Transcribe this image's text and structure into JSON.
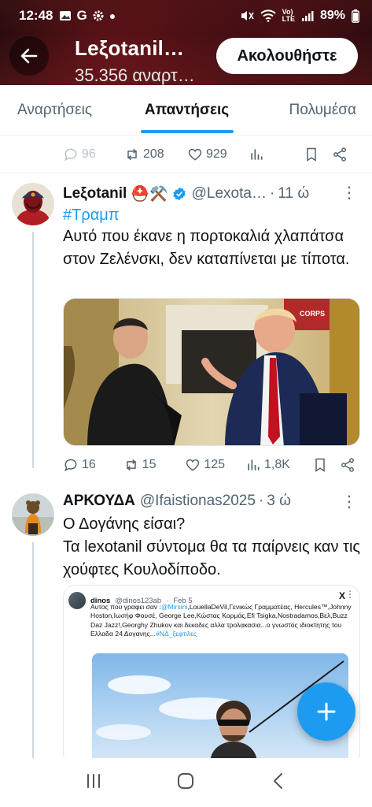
{
  "status_bar": {
    "time": "12:48",
    "left_icons": [
      "photo-icon",
      "google-icon",
      "gear-icon",
      "dot-icon"
    ],
    "right_icons": [
      "mute-icon",
      "wifi-icon",
      "volte-icon",
      "signal-icon"
    ],
    "battery": "89%"
  },
  "header": {
    "title": "Leξotanil…",
    "subtitle": "35.356 αναρτ…",
    "follow_label": "Ακολουθήστε"
  },
  "tabs": [
    {
      "label": "Αναρτήσεις",
      "active": false
    },
    {
      "label": "Απαντήσεις",
      "active": true
    },
    {
      "label": "Πολυμέσα",
      "active": false
    }
  ],
  "prev_tweet_actions": {
    "replies": "96",
    "retweets": "208",
    "likes": "929"
  },
  "tweet1": {
    "name": "Leξotanil",
    "badges": "⛑️⚒️",
    "handle": "@Lexota…",
    "time": "11 ώ",
    "hashtag": "#Τραμπ",
    "text": "Αυτό που έκανε η πορτοκαλιά χλαπάτσα στον Ζελένσκι, δεν καταπίνεται με τίποτα.",
    "flag_text": "CORPS",
    "replies": "16",
    "retweets": "15",
    "likes": "125",
    "views": "1,8K"
  },
  "tweet2": {
    "name": "ΑΡΚΟΥΔΑ",
    "handle": "@Ifaistionas2025",
    "time": "3 ώ",
    "text_line1": "Ο Δογάνης είσαι?",
    "text_line2": "Τα lexotanil σύντομα θα τα παίρνεις καν τις χούφτες Κουλοδίποδο.",
    "embed": {
      "name": "dinos",
      "handle": "@dinos123ab",
      "date": "Feb 5",
      "x_logo": "X",
      "text_a": "Αυτος που γραφει σαν :",
      "mention": "@Mirsini",
      "text_b": ",LouellaDeVil,Γενικώς Γραμματέας, Hercules™,Johnny Hoston,Ιωσήφ Φουσέ, George Lee,Κώστας Κορμάς,Efi Tsigka,Nostradamos,Βελ,Buzz Daz Jazz!,Georghy Zhukov και δεκαδες αλλα τρολακασια...ο γνωστος ιδιοκτητης του Ελλαδα 24 Δογανης...",
      "hashtag": "#ΝΔ_ξεφτιλες"
    }
  },
  "fab_icon": "plus-icon",
  "navbar": [
    "recents-icon",
    "home-icon",
    "back-icon"
  ]
}
